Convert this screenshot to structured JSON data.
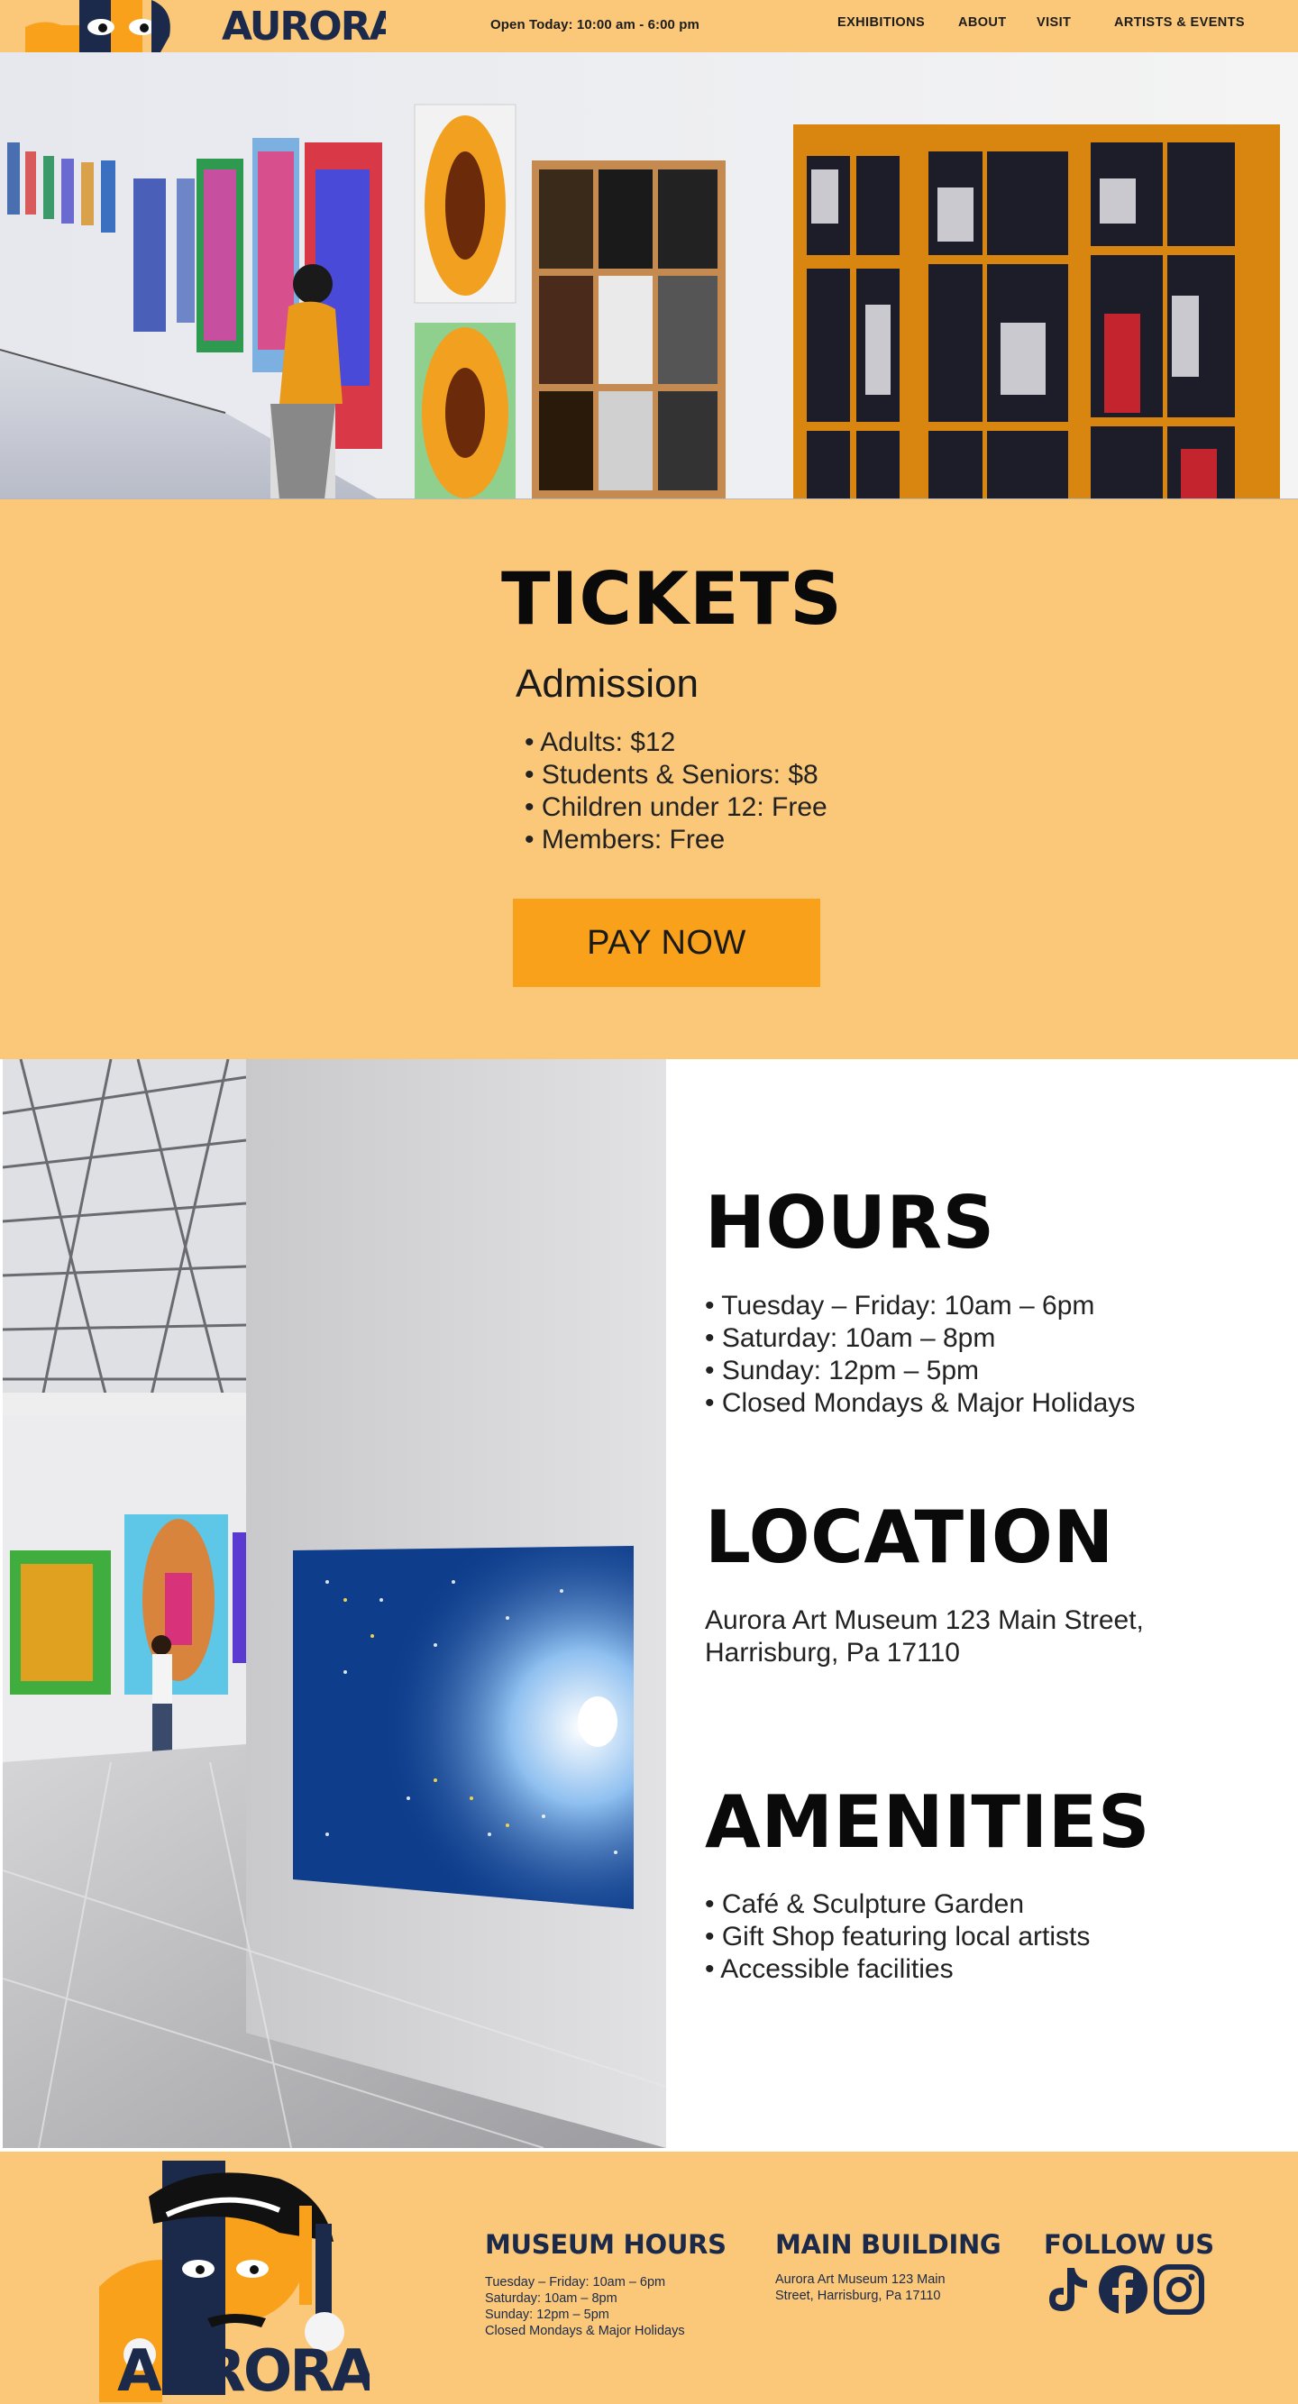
{
  "header": {
    "logo_text": "AURORA",
    "open_today": "Open Today:  10:00 am - 6:00 pm",
    "nav": [
      "EXHIBITIONS",
      "ABOUT",
      "VISIT",
      "ARTISTS & EVENTS"
    ]
  },
  "tickets": {
    "title": "TICKETS",
    "subtitle": "Admission",
    "prices": [
      "Adults: $12",
      "Students & Seniors: $8",
      "Children under 12: Free",
      "Members: Free"
    ],
    "button": "PAY NOW"
  },
  "hours": {
    "title": "HOURS",
    "items": [
      "Tuesday – Friday: 10am – 6pm",
      "Saturday: 10am – 8pm",
      "Sunday: 12pm – 5pm",
      "Closed Mondays & Major Holidays"
    ]
  },
  "location": {
    "title": "LOCATION",
    "address": "Aurora Art Museum 123 Main Street, Harrisburg, Pa 17110"
  },
  "amenities": {
    "title": "AMENITIES",
    "items": [
      "Café & Sculpture Garden",
      "Gift Shop featuring local artists",
      "Accessible facilities"
    ]
  },
  "footer": {
    "logo_text": "AURORA",
    "museum_hours_title": "MUSEUM HOURS",
    "museum_hours": [
      "Tuesday – Friday: 10am – 6pm",
      "Saturday: 10am – 8pm",
      "Sunday: 12pm – 5pm",
      "Closed Mondays & Major Holidays"
    ],
    "main_building_title": "MAIN BUILDING",
    "main_building": [
      "Aurora Art Museum 123 Main",
      "Street, Harrisburg, Pa 17110"
    ],
    "follow_title": "FOLLOW US",
    "social": [
      "tiktok-icon",
      "facebook-icon",
      "instagram-icon"
    ]
  },
  "colors": {
    "peach": "#fbc778",
    "orange": "#f9a11b",
    "navy": "#1b2a4a"
  }
}
